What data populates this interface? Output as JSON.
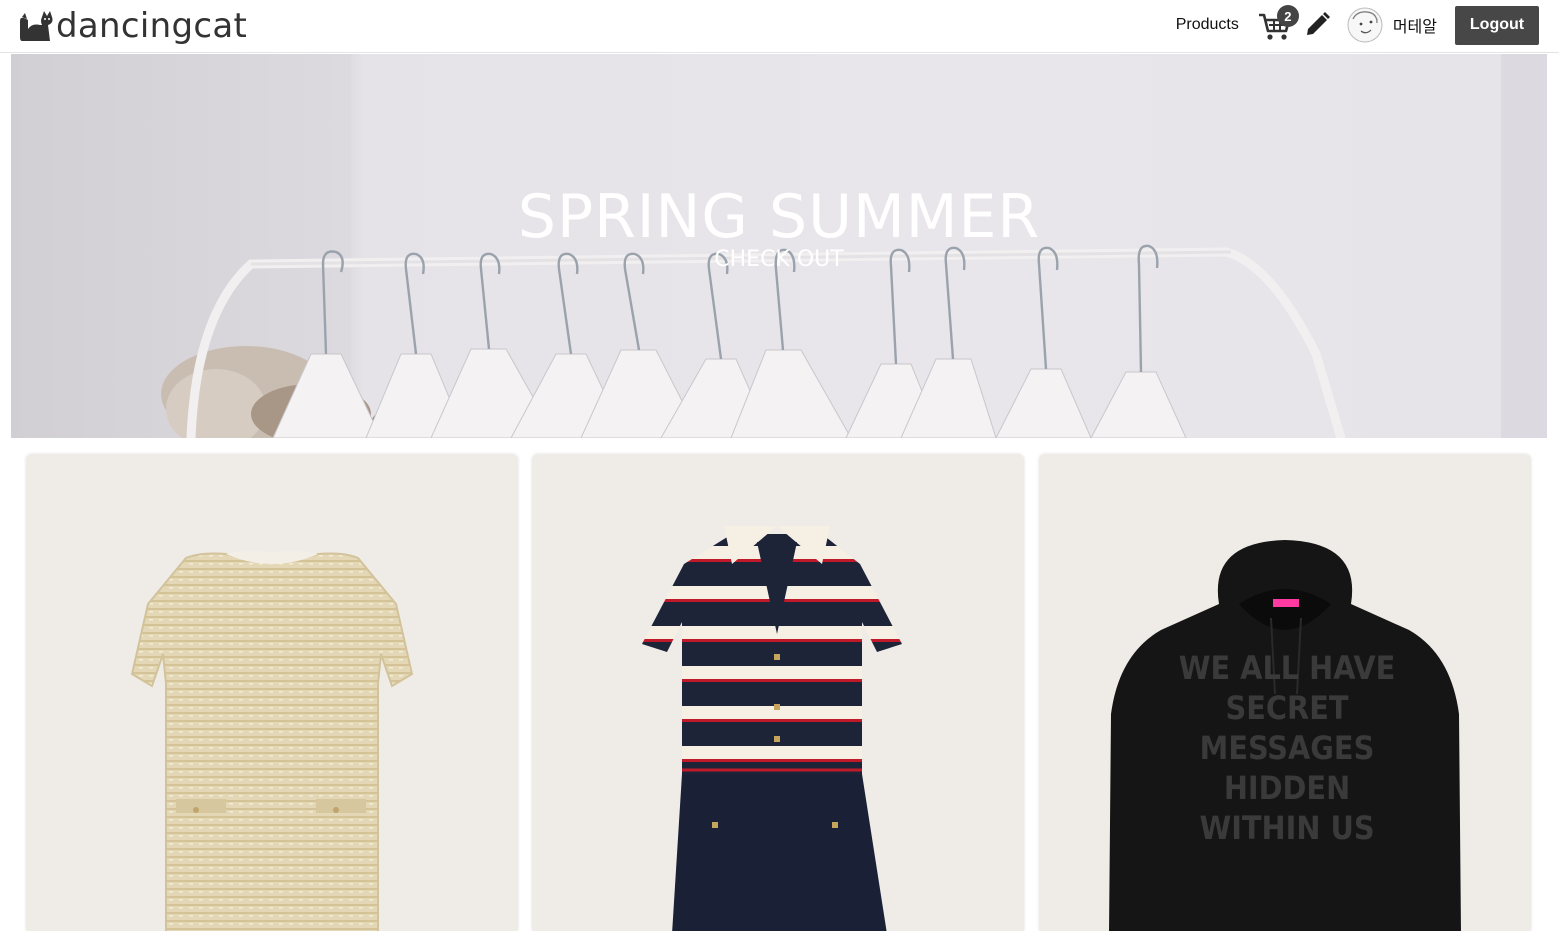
{
  "header": {
    "logo_text": "dancingcat",
    "nav_products": "Products",
    "cart_count": "2",
    "username": "머테알",
    "logout_label": "Logout"
  },
  "banner": {
    "title": "SPRING SUMMER",
    "subtitle": "CHECK OUT"
  },
  "products": [
    {
      "icon": "tweed-dress-image"
    },
    {
      "icon": "striped-knit-dress-image"
    },
    {
      "icon": "black-hoodie-image",
      "print_text": [
        "WE ALL HAVE",
        "SECRET",
        "MESSAGES",
        "HIDDEN",
        "WITHIN US"
      ]
    }
  ],
  "colors": {
    "logout_bg": "#474747",
    "card_bg": "#efece8",
    "badge_bg": "#444444"
  }
}
